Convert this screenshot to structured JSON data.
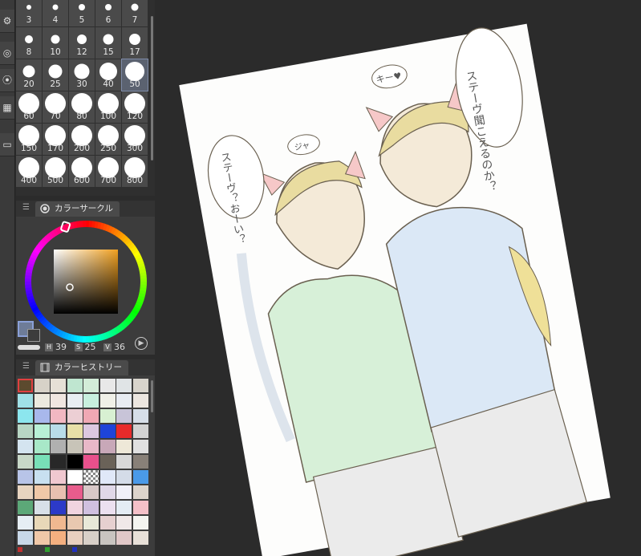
{
  "brush_sizes": [
    "3",
    "4",
    "5",
    "6",
    "7",
    "8",
    "10",
    "12",
    "15",
    "17",
    "20",
    "25",
    "30",
    "40",
    "50",
    "60",
    "70",
    "80",
    "100",
    "120",
    "150",
    "170",
    "200",
    "250",
    "300",
    "400",
    "500",
    "600",
    "700",
    "800"
  ],
  "selected_brush_size": "50",
  "color_circle_panel": {
    "title": "カラーサークル"
  },
  "hsv": {
    "h_label": "H",
    "h_value": "39",
    "s_label": "S",
    "s_value": "25",
    "v_label": "V",
    "v_value": "36"
  },
  "current_color": "#5c4a2e",
  "history_panel": {
    "title": "カラーヒストリー"
  },
  "history_colors": [
    "#5c4a2e",
    "#d7d2c8",
    "#e6e0d6",
    "#bfe6d0",
    "#d3ecd8",
    "#e8e8e8",
    "#e0e4e6",
    "#d8d4cc",
    "#a0e0e6",
    "#eceae0",
    "#f0e6e0",
    "#e8eef2",
    "#c8f0de",
    "#f0f0e8",
    "#e8ecf2",
    "#ece6e0",
    "#8ce6ee",
    "#a8b8ec",
    "#f2b8c2",
    "#eccfd4",
    "#f0a8b4",
    "#d8f0d2",
    "#c8c4d8",
    "#d6dee8",
    "#b8d6c4",
    "#b8f0d6",
    "#b8dce8",
    "#e8e0a8",
    "#dcc8e0",
    "#1e44d8",
    "#e82a2a",
    "#d2d2d2",
    "#d4e4f0",
    "#a8e8c8",
    "#b0b0b0",
    "#c8c4b8",
    "#e8b8c8",
    "#c8a8b8",
    "#eee8d8",
    "#e0e0e0",
    "#c8d8c8",
    "#78e0b8",
    "#282828",
    "#000000",
    "#e8508c",
    "#6a6258",
    "#d8d8d8",
    "#888078",
    "#b8c4e8",
    "#c8e0f0",
    "#f0c8d0",
    "#ffffff",
    "#checker",
    "#e0e8f8",
    "#d4dce8",
    "#4a9ae8",
    "#e8d4c0",
    "#f0c8a8",
    "#e8c0b0",
    "#e85c8c",
    "#d8c8c8",
    "#e0d8e8",
    "#f0f0f8",
    "#dcd4cc",
    "#5ca878",
    "#d8e0e8",
    "#2c3ac8",
    "#f0d4e0",
    "#d0c0e0",
    "#ece0f0",
    "#e4ecf4",
    "#f4c0c8",
    "#e6eef4",
    "#e8d8b8",
    "#f0b890",
    "#e8c8b0",
    "#e8e8d8",
    "#e6d0d0",
    "#f0e8e8",
    "#f4f4f0",
    "#c8d8e8",
    "#f0c8a8",
    "#f4b080",
    "#e8d0c0",
    "#d8d0c8",
    "#c8c4c0",
    "#e0c8c8",
    "#e8e0d8"
  ],
  "canvas": {
    "speech_1": "ステーヴ聞こえるのか？",
    "speech_2": "ステーヴ？おーい？",
    "sfx_1": "キー♥",
    "sfx_2": "ジャ"
  }
}
